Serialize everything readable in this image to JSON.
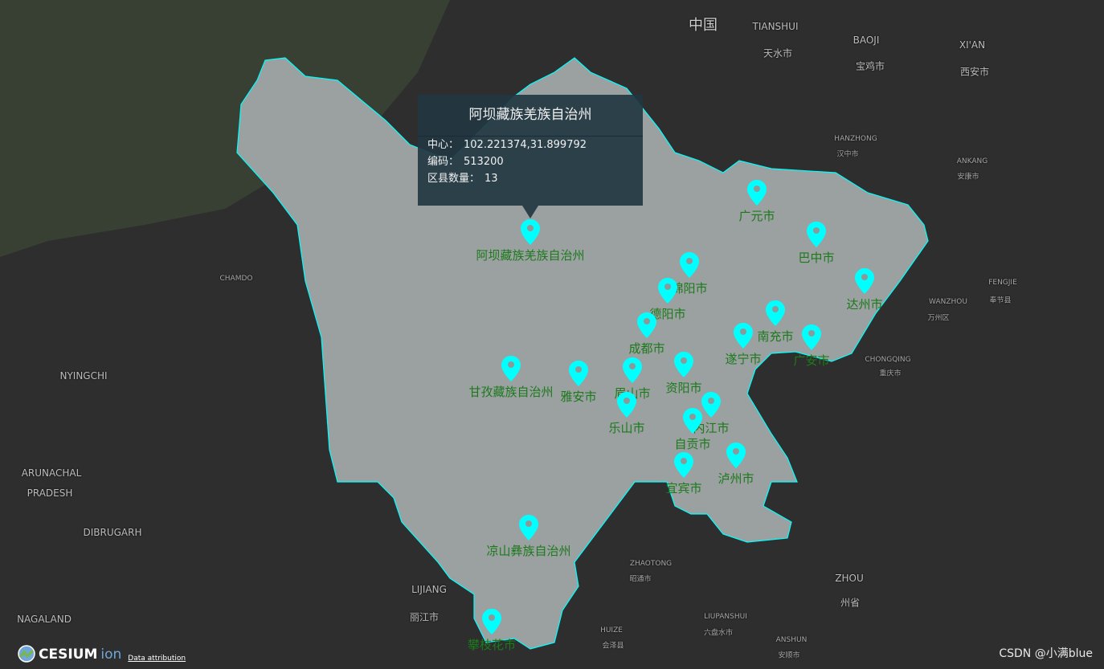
{
  "colors": {
    "region_fill": "#9ba0a0",
    "region_border": "#00ffff",
    "marker": "#00ffff",
    "label": "#1c7a1c",
    "background": "#2e2e2e"
  },
  "popup": {
    "title": "阿坝藏族羌族自治州",
    "center_label": "中心：",
    "center_value": "102.221374,31.899792",
    "code_label": "编码：",
    "code_value": "513200",
    "county_label": "区县数量：",
    "county_value": "13"
  },
  "markers": [
    {
      "name": "阿坝藏族羌族自治州",
      "icon": "map-pin-icon"
    },
    {
      "name": "广元市",
      "icon": "map-pin-icon"
    },
    {
      "name": "巴中市",
      "icon": "map-pin-icon"
    },
    {
      "name": "绵阳市",
      "icon": "map-pin-icon"
    },
    {
      "name": "德阳市",
      "icon": "map-pin-icon"
    },
    {
      "name": "达州市",
      "icon": "map-pin-icon"
    },
    {
      "name": "南充市",
      "icon": "map-pin-icon"
    },
    {
      "name": "成都市",
      "icon": "map-pin-icon"
    },
    {
      "name": "遂宁市",
      "icon": "map-pin-icon"
    },
    {
      "name": "广安市",
      "icon": "map-pin-icon"
    },
    {
      "name": "甘孜藏族自治州",
      "icon": "map-pin-icon"
    },
    {
      "name": "雅安市",
      "icon": "map-pin-icon"
    },
    {
      "name": "眉山市",
      "icon": "map-pin-icon"
    },
    {
      "name": "资阳市",
      "icon": "map-pin-icon"
    },
    {
      "name": "乐山市",
      "icon": "map-pin-icon"
    },
    {
      "name": "内江市",
      "icon": "map-pin-icon"
    },
    {
      "name": "自贡市",
      "icon": "map-pin-icon"
    },
    {
      "name": "泸州市",
      "icon": "map-pin-icon"
    },
    {
      "name": "宜宾市",
      "icon": "map-pin-icon"
    },
    {
      "name": "凉山彝族自治州",
      "icon": "map-pin-icon"
    },
    {
      "name": "攀枝花市",
      "icon": "map-pin-icon"
    }
  ],
  "basemap_labels": [
    "中国",
    "TIANSHUI",
    "天水市",
    "BAOJI",
    "宝鸡市",
    "XI'AN",
    "西安市",
    "HANZHONG",
    "汉中市",
    "ANKANG",
    "安康市",
    "FENGJIE",
    "奉节县",
    "WANZHOU",
    "万州区",
    "CHONGQING",
    "重庆市",
    "CHAMDO",
    "NYINGCHI",
    "ARUNACHAL",
    "PRADESH",
    "DIBRUGARH",
    "NAGALAND",
    "LIJIANG",
    "丽江市",
    "ZHAOTONG",
    "昭通市",
    "HUIZE",
    "会泽县",
    "LIUPANSHUI",
    "六盘水市",
    "ANSHUN",
    "安顺市",
    "ZHOU",
    "州省"
  ],
  "footer": {
    "logo_text": "CESIUM",
    "logo_suffix": "ion",
    "attribution": "Data attribution",
    "watermark": "CSDN @小满blue"
  }
}
